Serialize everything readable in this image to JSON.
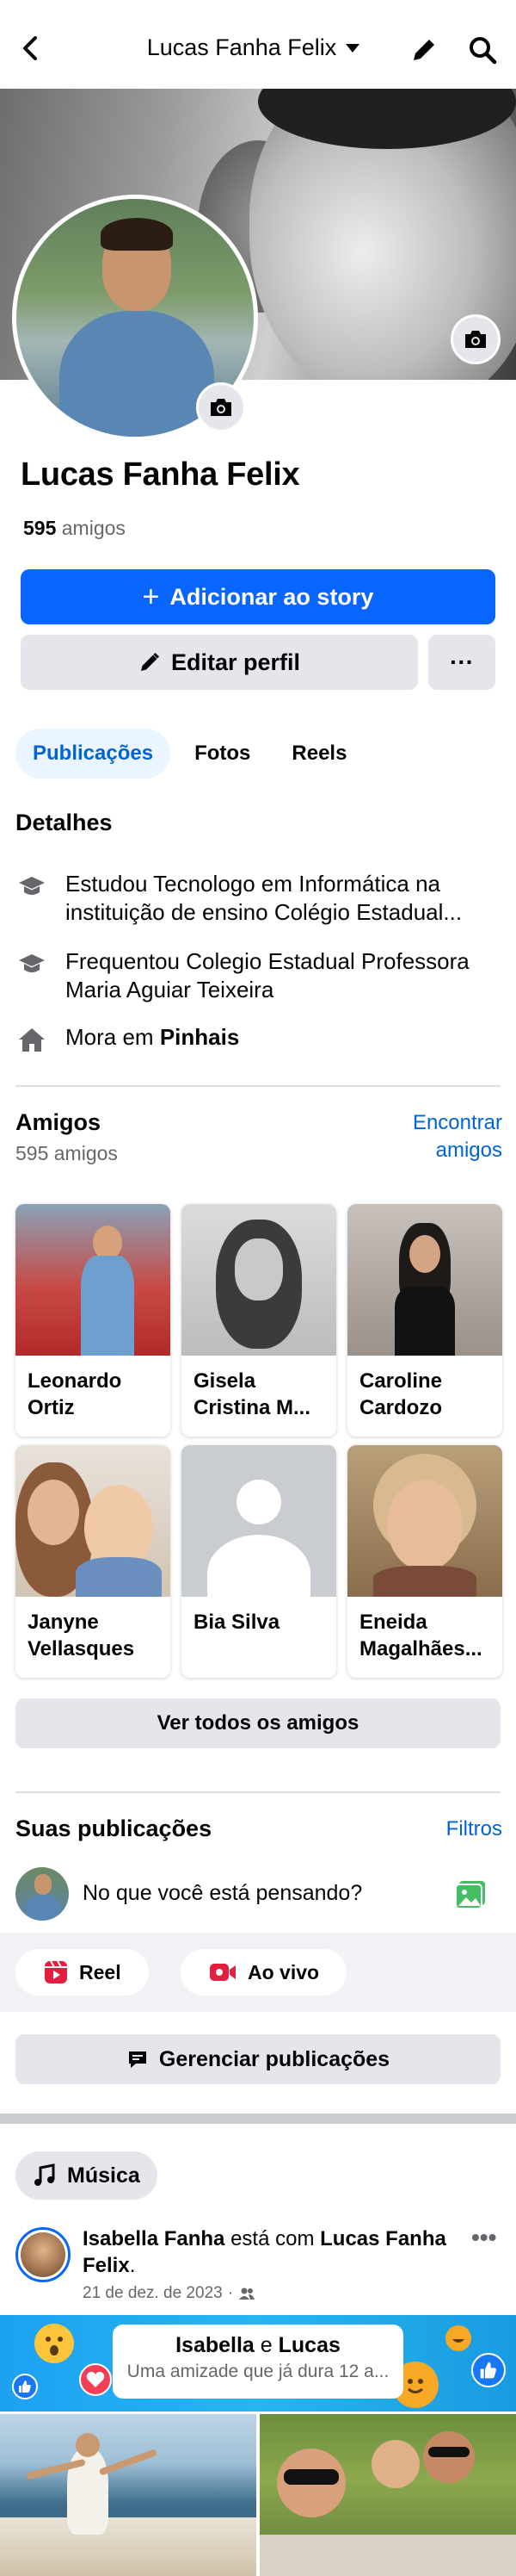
{
  "header": {
    "title": "Lucas Fanha Felix"
  },
  "profile": {
    "name": "Lucas Fanha Felix",
    "friends_number": "595",
    "friends_word": "amigos"
  },
  "actions": {
    "add_story": "Adicionar ao story",
    "add_story_plus": "+",
    "edit_profile": "Editar perfil",
    "more": "···"
  },
  "tabs": [
    {
      "label": "Publicações",
      "active": true
    },
    {
      "label": "Fotos",
      "active": false
    },
    {
      "label": "Reels",
      "active": false
    }
  ],
  "details": {
    "title": "Detalhes",
    "items": [
      {
        "icon": "education-cap-icon",
        "text": "Estudou Tecnologo em Informática na instituição de ensino Colégio Estadual..."
      },
      {
        "icon": "education-cap-icon",
        "text": "Frequentou Colegio Estadual Professora Maria Aguiar Teixeira"
      },
      {
        "icon": "home-icon",
        "prefix": "Mora em ",
        "bold": "Pinhais"
      }
    ]
  },
  "friends": {
    "title": "Amigos",
    "count_text": "595 amigos",
    "find_link": "Encontrar amigos",
    "list": [
      {
        "name": "Leonardo Ortiz"
      },
      {
        "name": "Gisela Cristina M..."
      },
      {
        "name": "Caroline Cardozo"
      },
      {
        "name": "Janyne Vellasques"
      },
      {
        "name": "Bia Silva"
      },
      {
        "name": "Eneida Magalhães..."
      }
    ],
    "see_all": "Ver todos os amigos"
  },
  "posts": {
    "title": "Suas publicações",
    "filters": "Filtros",
    "composer_placeholder": "No que você está pensando?",
    "reel": "Reel",
    "live": "Ao vivo",
    "manage": "Gerenciar publicações"
  },
  "feed": {
    "chip": "Música",
    "post": {
      "author": "Isabella Fanha",
      "connector": " está com ",
      "tagged": "Lucas Fanha Felix",
      "tagged_suffix": ".",
      "date": "21 de dez. de 2023",
      "date_sep": "·",
      "banner_name1": "Isabella",
      "banner_and": " e ",
      "banner_name2": "Lucas",
      "banner_sub": "Uma amizade que já dura 12 a..."
    }
  },
  "colors": {
    "primary": "#0866ff",
    "link": "#0064d1",
    "button_gray": "#e4e6eb",
    "text_secondary": "#65676b"
  }
}
